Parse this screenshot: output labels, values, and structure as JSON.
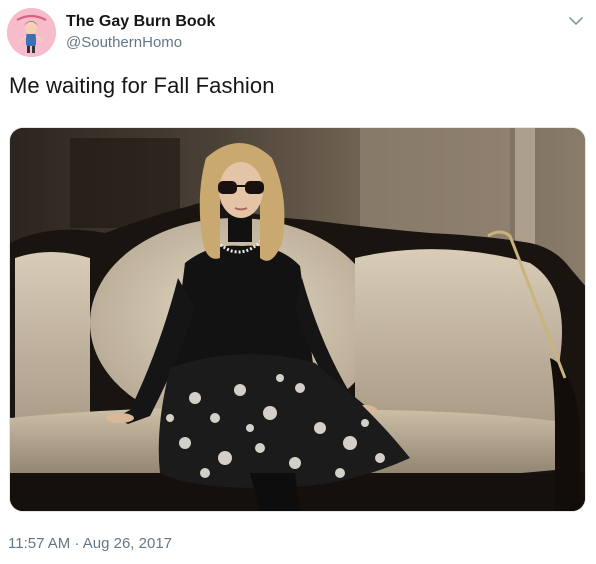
{
  "tweet": {
    "display_name": "The Gay Burn Book",
    "handle": "@SouthernHomo",
    "text": "Me waiting for Fall Fashion",
    "timestamp": "11:57 AM · Aug 26, 2017",
    "avatar_icon": "cartoon-avatar-icon",
    "menu_icon": "chevron-down-icon",
    "media_description_icon": "photo-woman-on-sofa"
  },
  "colors": {
    "text_primary": "#14171a",
    "text_secondary": "#657786",
    "avatar_pink": "#f7c1cf",
    "caret": "#8899a6"
  }
}
